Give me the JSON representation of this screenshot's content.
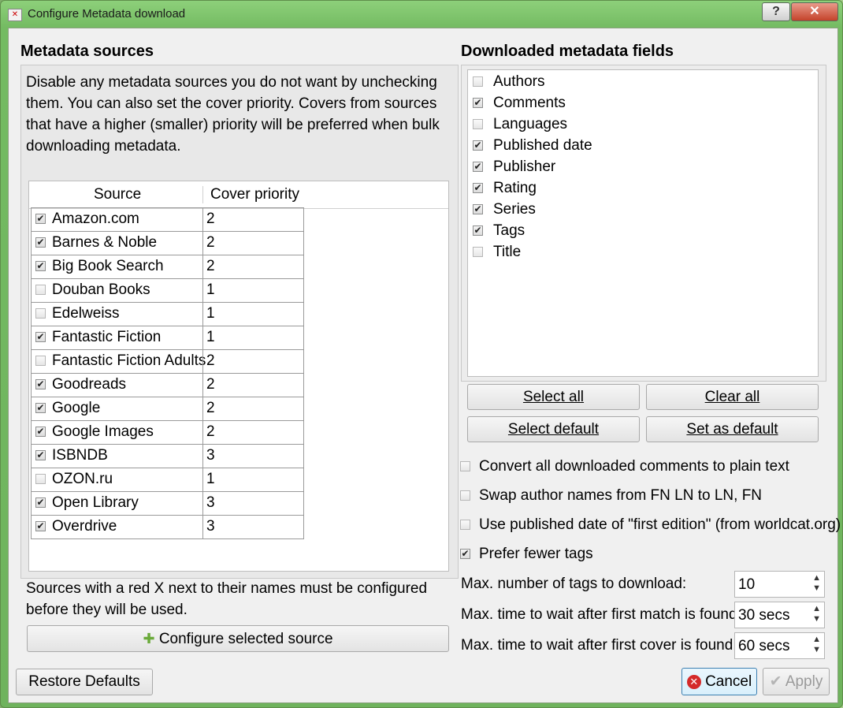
{
  "window": {
    "title": "Configure Metadata download",
    "help_label": "?",
    "close_label": "✕"
  },
  "sources_panel": {
    "heading": "Metadata sources",
    "description": "Disable any metadata sources you do not want by unchecking them. You can also set the cover priority. Covers from sources that have a higher (smaller) priority will be preferred when bulk downloading metadata.",
    "columns": [
      "Source",
      "Cover priority"
    ],
    "rows": [
      {
        "name": "Amazon.com",
        "checked": true,
        "priority": "2"
      },
      {
        "name": "Barnes & Noble",
        "checked": true,
        "priority": "2"
      },
      {
        "name": "Big Book Search",
        "checked": true,
        "priority": "2"
      },
      {
        "name": "Douban Books",
        "checked": false,
        "priority": "1"
      },
      {
        "name": "Edelweiss",
        "checked": false,
        "priority": "1"
      },
      {
        "name": "Fantastic Fiction",
        "checked": true,
        "priority": "1"
      },
      {
        "name": "Fantastic Fiction Adults",
        "checked": false,
        "priority": "2"
      },
      {
        "name": "Goodreads",
        "checked": true,
        "priority": "2"
      },
      {
        "name": "Google",
        "checked": true,
        "priority": "2"
      },
      {
        "name": "Google Images",
        "checked": true,
        "priority": "2"
      },
      {
        "name": "ISBNDB",
        "checked": true,
        "priority": "3"
      },
      {
        "name": "OZON.ru",
        "checked": false,
        "priority": "1"
      },
      {
        "name": "Open Library",
        "checked": true,
        "priority": "3"
      },
      {
        "name": "Overdrive",
        "checked": true,
        "priority": "3"
      }
    ],
    "note": "Sources with a red X next to their names must be configured before they will be used.",
    "configure_button": "Configure selected source"
  },
  "fields_panel": {
    "heading": "Downloaded metadata fields",
    "fields": [
      {
        "name": "Authors",
        "checked": false
      },
      {
        "name": "Comments",
        "checked": true
      },
      {
        "name": "Languages",
        "checked": false
      },
      {
        "name": "Published date",
        "checked": true
      },
      {
        "name": "Publisher",
        "checked": true
      },
      {
        "name": "Rating",
        "checked": true
      },
      {
        "name": "Series",
        "checked": true
      },
      {
        "name": "Tags",
        "checked": true
      },
      {
        "name": "Title",
        "checked": false
      }
    ],
    "select_all": "Select all",
    "clear_all": "Clear all",
    "select_default": "Select default",
    "set_as_default": "Set as default"
  },
  "options": [
    {
      "label": "Convert all downloaded comments to plain text",
      "checked": false
    },
    {
      "label": "Swap author names from FN LN to LN, FN",
      "checked": false
    },
    {
      "label": "Use published date of \"first edition\" (from worldcat.org)",
      "checked": false
    },
    {
      "label": "Prefer fewer tags",
      "checked": true
    }
  ],
  "spinners": [
    {
      "label": "Max. number of tags to download:",
      "value": "10"
    },
    {
      "label": "Max. time to wait after first match is found:",
      "value": "30 secs"
    },
    {
      "label": "Max. time to wait after first cover is found:",
      "value": "60 secs"
    }
  ],
  "footer": {
    "restore_defaults": "Restore Defaults",
    "cancel": "Cancel",
    "apply": "Apply"
  },
  "icons": {
    "checkmark": "✔",
    "spin_arrows": "⌃⌄"
  }
}
